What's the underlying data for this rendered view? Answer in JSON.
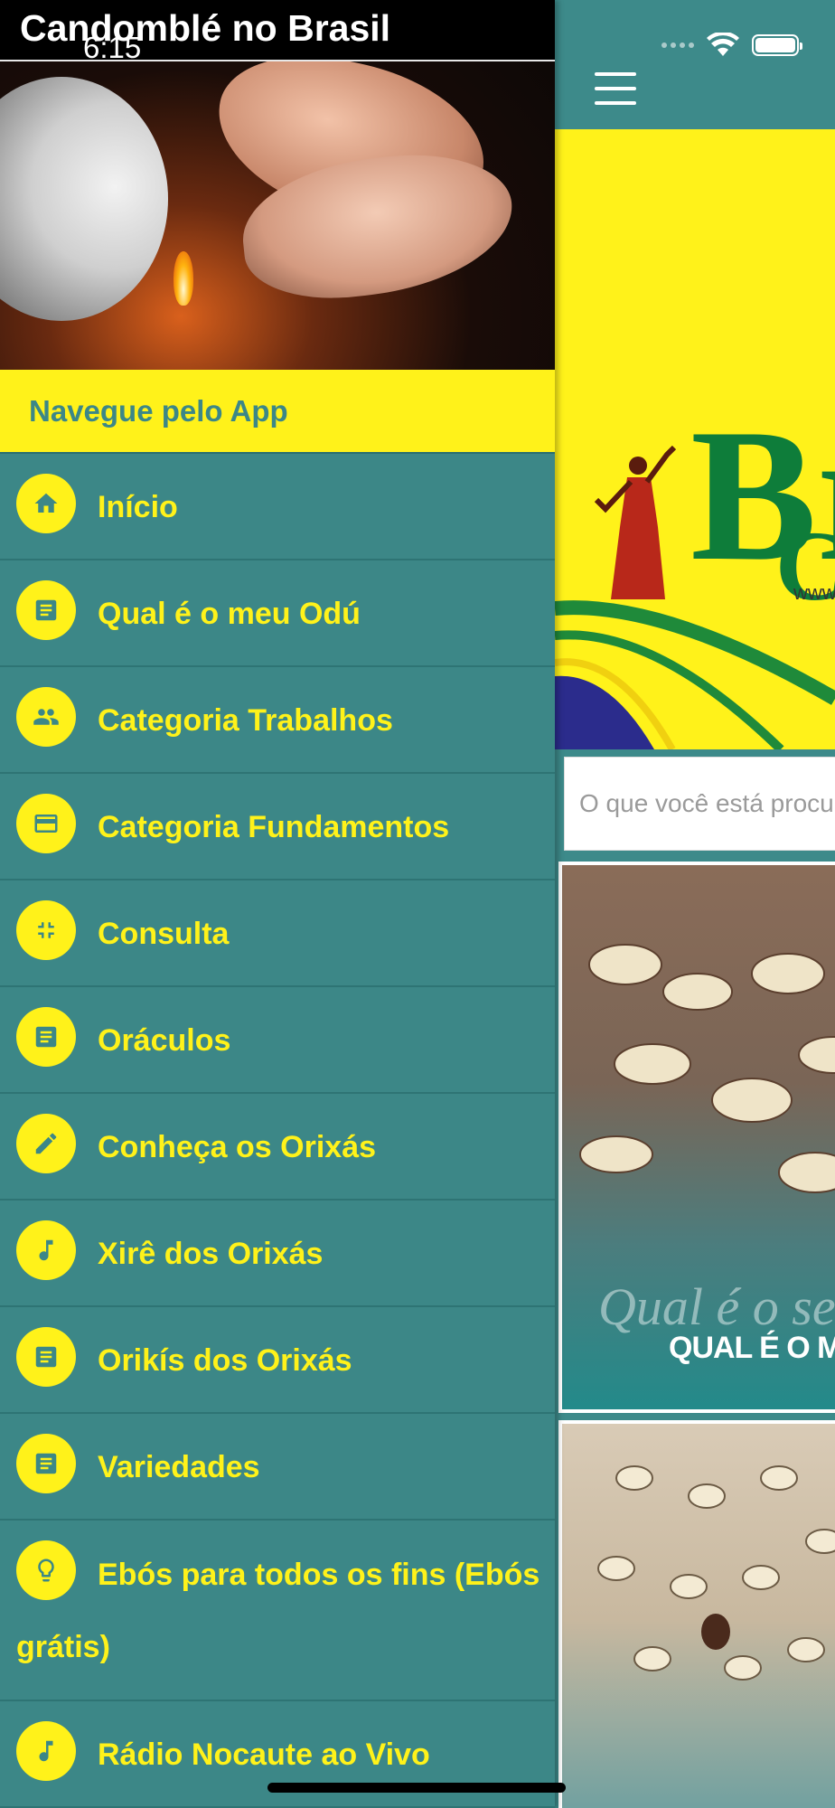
{
  "status_bar": {
    "time": "6:15"
  },
  "drawer": {
    "app_title": "Candomblé no Brasil",
    "header_label": "Navegue pelo App",
    "items": [
      {
        "label": "Início",
        "icon": "home-icon"
      },
      {
        "label": "Qual é o meu Odú",
        "icon": "article-icon"
      },
      {
        "label": "Categoria Trabalhos",
        "icon": "people-icon"
      },
      {
        "label": "Categoria Fundamentos",
        "icon": "card-icon"
      },
      {
        "label": "Consulta",
        "icon": "collapse-icon"
      },
      {
        "label": "Oráculos",
        "icon": "article-icon"
      },
      {
        "label": "Conheça os Orixás",
        "icon": "pencil-icon"
      },
      {
        "label": "Xirê dos Orixás",
        "icon": "music-note-icon"
      },
      {
        "label": "Orikís dos Orixás",
        "icon": "article-icon"
      },
      {
        "label": "Variedades",
        "icon": "article-icon"
      },
      {
        "label": "Ebós para todos os fins (Ebós grátis)",
        "icon": "lightbulb-icon"
      },
      {
        "label": "Rádio Nocaute ao Vivo",
        "icon": "music-note-icon"
      }
    ]
  },
  "main": {
    "banner": {
      "letter_c": "C",
      "letter_b": "Br",
      "url_fragment": "www"
    },
    "search": {
      "placeholder": "O que você está procurando?"
    },
    "cards": [
      {
        "script_text": "Qual é o seu",
        "caps_text": "QUAL É O MEU ODÚ"
      }
    ]
  },
  "colors": {
    "teal": "#3c8787",
    "yellow": "#fff21a",
    "green_logo": "#0e7d3a"
  }
}
